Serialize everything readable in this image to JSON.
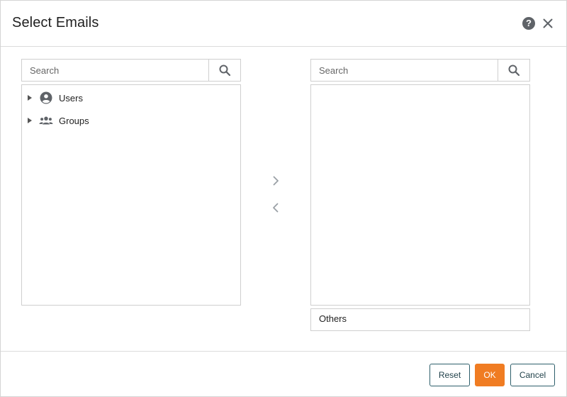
{
  "dialog": {
    "title": "Select Emails"
  },
  "icons": {
    "help": "help-circle-icon",
    "close": "close-icon",
    "search": "search-icon",
    "user": "user-circle-icon",
    "group": "group-icon",
    "move_right": "chevron-right-icon",
    "move_left": "chevron-left-icon",
    "help_glyph": "?"
  },
  "left_panel": {
    "search_placeholder": "Search",
    "tree": [
      {
        "label": "Users",
        "icon": "user-circle-icon"
      },
      {
        "label": "Groups",
        "icon": "group-icon"
      }
    ]
  },
  "right_panel": {
    "search_placeholder": "Search",
    "items": [],
    "others_label": "Others"
  },
  "footer": {
    "reset_label": "Reset",
    "ok_label": "OK",
    "cancel_label": "Cancel"
  },
  "colors": {
    "primary": "#f07c22",
    "outline_button": "#2e5f6b",
    "icon_gray": "#5f6368",
    "border": "#cfcfcf"
  }
}
